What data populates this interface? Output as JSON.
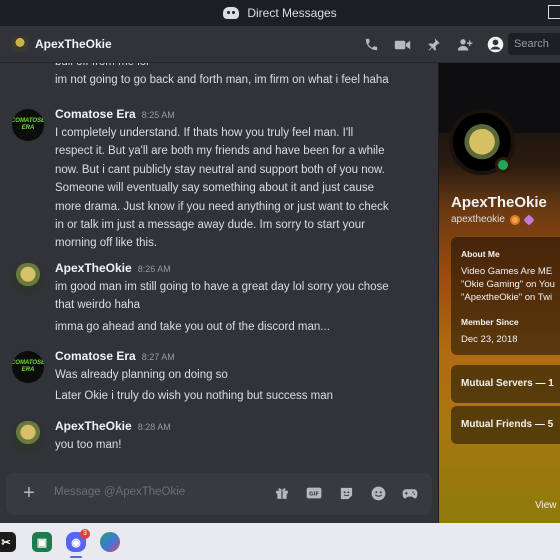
{
  "titlebar": {
    "title": "Direct Messages"
  },
  "header": {
    "dm_name": "ApexTheOkie",
    "search_placeholder": "Search",
    "icons": [
      "phone-call-icon",
      "video-call-icon",
      "pinned-messages-icon",
      "add-friends-to-dm-icon",
      "user-profile-icon"
    ]
  },
  "messages": {
    "cut_line": "bull off from me lol",
    "earlier_line": "im not going to go back and forth man, im firm on what i feel haha",
    "groups": [
      {
        "author": "Comatose Era",
        "avatar_text": "COMATOSE ERA",
        "time": "8:25 AM",
        "lines": [
          "I completely understand. If thats how you truly feel man. I'll",
          "respect it. But ya'll are both my friends and have been for a while",
          "now. But i cant publicly stay neutral and support both of you now.",
          "Someone will eventually say something about it and just cause",
          "more drama. Just know if you need anything or just want to check",
          "in or talk im just a message away dude. Im sorry to start your",
          "morning off like this."
        ]
      },
      {
        "author": "ApexTheOkie",
        "time": "8:26 AM",
        "lines": [
          "im good man im still going to have a great day lol sorry you chose",
          "that weirdo haha"
        ],
        "followup": "imma go ahead and take you out of the discord man..."
      },
      {
        "author": "Comatose Era",
        "avatar_text": "COMATOSE ERA",
        "time": "8:27 AM",
        "lines": [
          "Was already planning on doing so"
        ],
        "followup": "Later Okie i truly do wish you nothing but success man"
      },
      {
        "author": "ApexTheOkie",
        "time": "8:28 AM",
        "lines": [
          "you too man!"
        ]
      }
    ]
  },
  "composer": {
    "placeholder": "Message @ApexTheOkie",
    "gif_label": "GIF",
    "icons": [
      "add-attachment-icon",
      "gift-icon",
      "gif-icon",
      "sticker-icon",
      "emoji-icon",
      "activities-icon"
    ]
  },
  "profile": {
    "display_name": "ApexTheOkie",
    "username": "apextheokie",
    "status": "online",
    "about_title": "About Me",
    "about_lines": [
      "Video Games Are ME",
      "\"Okie Gaming\" on You",
      "\"ApextheOkie\" on Twi"
    ],
    "member_since_title": "Member Since",
    "member_since": "Dec 23, 2018",
    "mutual_servers": "Mutual Servers — 1",
    "mutual_friends": "Mutual Friends — 5",
    "view_full": "View Fu"
  },
  "taskbar": {
    "apps": [
      "capcut-app-icon",
      "streamlabs-app-icon",
      "discord-app-icon",
      "browser-app-icon"
    ],
    "discord_badge": "3"
  },
  "colors": {
    "chat_bg": "#313338",
    "sidebar_bg": "#1e1f22",
    "online": "#23a55a",
    "discord_blurple": "#5865f2",
    "text": "#dbdee1"
  }
}
